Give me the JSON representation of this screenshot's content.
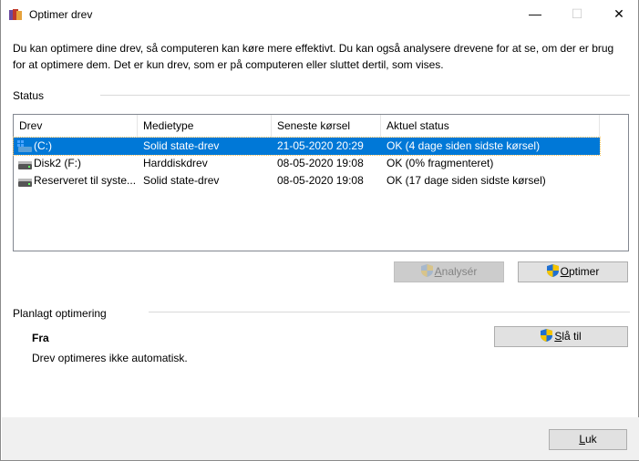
{
  "window": {
    "title": "Optimer drev",
    "minimize": "—",
    "maximize": "☐",
    "close": "✕"
  },
  "description": "Du kan optimere dine drev, så computeren kan køre mere effektivt. Du kan også analysere drevene for at se, om der er brug for at optimere dem. Det er kun drev, som er på computeren eller sluttet dertil, som vises.",
  "status": {
    "label": "Status",
    "columns": [
      "Drev",
      "Medietype",
      "Seneste kørsel",
      "Aktuel status"
    ],
    "rows": [
      {
        "drive": "(C:)",
        "media": "Solid state-drev",
        "last": "21-05-2020 20:29",
        "status": "OK (4 dage siden sidste kørsel)",
        "icon": "windows-drive-icon",
        "selected": true
      },
      {
        "drive": "Disk2 (F:)",
        "media": "Harddiskdrev",
        "last": "08-05-2020 19:08",
        "status": "OK (0% fragmenteret)",
        "icon": "drive-icon",
        "selected": false
      },
      {
        "drive": "Reserveret til syste...",
        "media": "Solid state-drev",
        "last": "08-05-2020 19:08",
        "status": "OK (17 dage siden sidste kørsel)",
        "icon": "drive-icon",
        "selected": false
      }
    ]
  },
  "buttons": {
    "analyze_first": "A",
    "analyze_rest": "nalysér",
    "optimize_first": "O",
    "optimize_rest": "ptimer"
  },
  "schedule": {
    "label": "Planlagt optimering",
    "state": "Fra",
    "detail": "Drev optimeres ikke automatisk.",
    "turn_on_first": "S",
    "turn_on_rest": "lå til"
  },
  "footer": {
    "close_first": "L",
    "close_rest": "uk"
  },
  "colors": {
    "selection": "#0078d7",
    "footer": "#f0f0f0"
  }
}
